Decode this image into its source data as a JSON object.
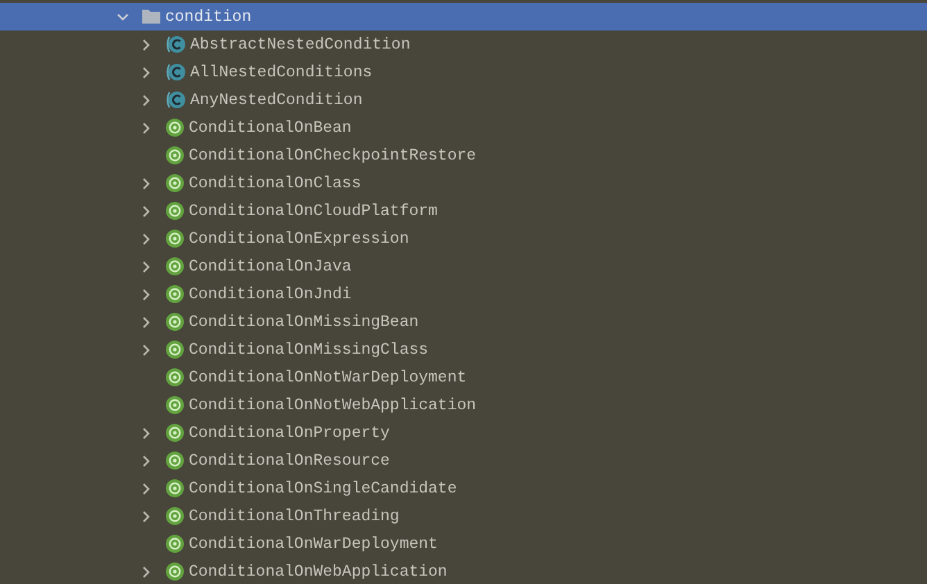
{
  "tree": [
    {
      "label": "condition",
      "kind": "folder",
      "expanded": true,
      "selected": true,
      "children": [
        {
          "label": "AbstractNestedCondition",
          "kind": "abstract-class",
          "expandable": true,
          "selected": false
        },
        {
          "label": "AllNestedConditions",
          "kind": "abstract-class",
          "expandable": true,
          "selected": false
        },
        {
          "label": "AnyNestedCondition",
          "kind": "abstract-class",
          "expandable": true,
          "selected": false
        },
        {
          "label": "ConditionalOnBean",
          "kind": "annotation",
          "expandable": true,
          "selected": false
        },
        {
          "label": "ConditionalOnCheckpointRestore",
          "kind": "annotation",
          "expandable": false,
          "selected": false
        },
        {
          "label": "ConditionalOnClass",
          "kind": "annotation",
          "expandable": true,
          "selected": false
        },
        {
          "label": "ConditionalOnCloudPlatform",
          "kind": "annotation",
          "expandable": true,
          "selected": false
        },
        {
          "label": "ConditionalOnExpression",
          "kind": "annotation",
          "expandable": true,
          "selected": false
        },
        {
          "label": "ConditionalOnJava",
          "kind": "annotation",
          "expandable": true,
          "selected": false
        },
        {
          "label": "ConditionalOnJndi",
          "kind": "annotation",
          "expandable": true,
          "selected": false
        },
        {
          "label": "ConditionalOnMissingBean",
          "kind": "annotation",
          "expandable": true,
          "selected": false
        },
        {
          "label": "ConditionalOnMissingClass",
          "kind": "annotation",
          "expandable": true,
          "selected": false
        },
        {
          "label": "ConditionalOnNotWarDeployment",
          "kind": "annotation",
          "expandable": false,
          "selected": false
        },
        {
          "label": "ConditionalOnNotWebApplication",
          "kind": "annotation",
          "expandable": false,
          "selected": false
        },
        {
          "label": "ConditionalOnProperty",
          "kind": "annotation",
          "expandable": true,
          "selected": false
        },
        {
          "label": "ConditionalOnResource",
          "kind": "annotation",
          "expandable": true,
          "selected": false
        },
        {
          "label": "ConditionalOnSingleCandidate",
          "kind": "annotation",
          "expandable": true,
          "selected": false
        },
        {
          "label": "ConditionalOnThreading",
          "kind": "annotation",
          "expandable": true,
          "selected": false
        },
        {
          "label": "ConditionalOnWarDeployment",
          "kind": "annotation",
          "expandable": false,
          "selected": false
        },
        {
          "label": "ConditionalOnWebApplication",
          "kind": "annotation",
          "expandable": true,
          "selected": false
        }
      ]
    }
  ]
}
